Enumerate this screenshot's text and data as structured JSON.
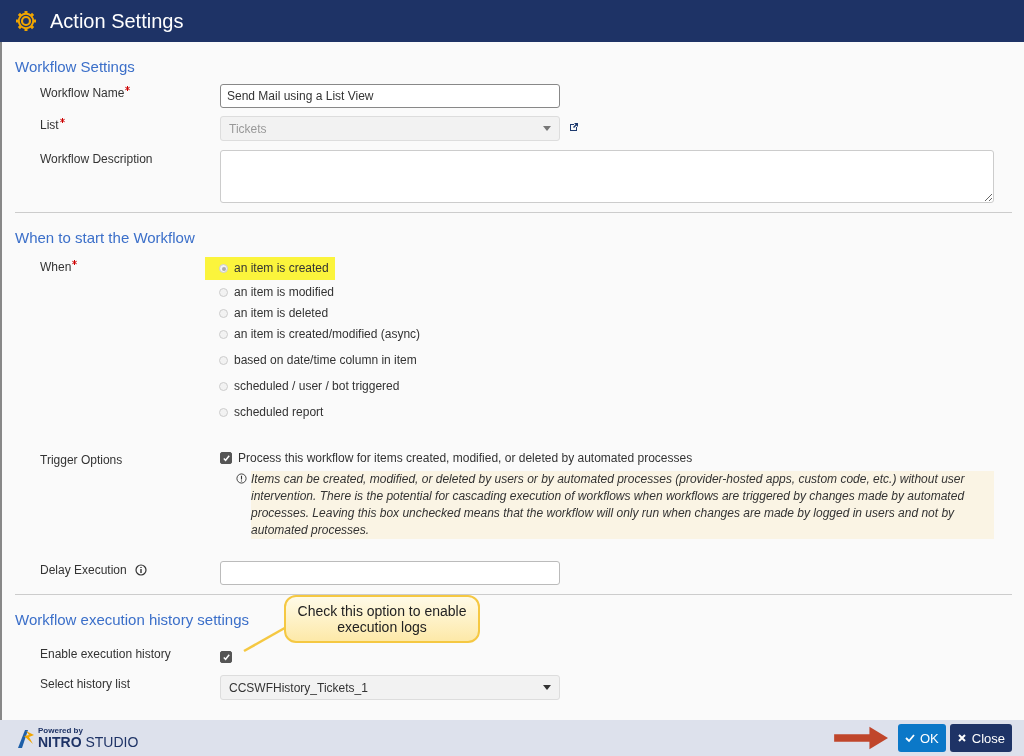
{
  "window": {
    "title": "Action Settings"
  },
  "workflow_settings": {
    "title": "Workflow Settings",
    "name": {
      "label": "Workflow Name",
      "required": true,
      "value": "Send Mail using a List View"
    },
    "list": {
      "label": "List",
      "required": true,
      "value": "Tickets",
      "disabled": true
    },
    "description": {
      "label": "Workflow Description"
    }
  },
  "when_section": {
    "title": "When to start the Workflow",
    "label": "When",
    "required": true,
    "options": [
      {
        "label": "an item is created",
        "selected": true,
        "highlighted": true
      },
      {
        "label": "an item is modified",
        "selected": false,
        "highlighted": false
      },
      {
        "label": "an item is deleted",
        "selected": false,
        "highlighted": false
      },
      {
        "label": "an item is created/modified (async)",
        "selected": false,
        "highlighted": false
      },
      {
        "label": "based on date/time column in item",
        "selected": false,
        "highlighted": false
      },
      {
        "label": "scheduled / user / bot triggered",
        "selected": false,
        "highlighted": false
      },
      {
        "label": "scheduled report",
        "selected": false,
        "highlighted": false
      }
    ],
    "trigger_options": {
      "label": "Trigger Options",
      "checkbox_label": "Process this workflow for items created, modified, or deleted by automated processes",
      "checked": true,
      "note": "Items can be created, modified, or deleted by users or by automated processes (provider-hosted apps, custom code, etc.) without user intervention. There is the potential for cascading execution of workflows when workflows are triggered by changes made by automated processes. Leaving this box unchecked means that the workflow will only run when changes are made by logged in users and not by automated processes."
    },
    "delay": {
      "label": "Delay Execution"
    }
  },
  "history_section": {
    "title": "Workflow execution history settings",
    "enable": {
      "label": "Enable execution history",
      "checked": true
    },
    "list": {
      "label": "Select history list",
      "value": "CCSWFHistory_Tickets_1"
    },
    "callout": "Check this option to enable execution logs"
  },
  "footer": {
    "brand_small": "Powered by",
    "brand_bold": "NITRO",
    "brand_light": "STUDIO",
    "buttons": [
      {
        "label": "OK",
        "kind": "primary"
      },
      {
        "label": "Close",
        "kind": "secondary"
      }
    ]
  }
}
